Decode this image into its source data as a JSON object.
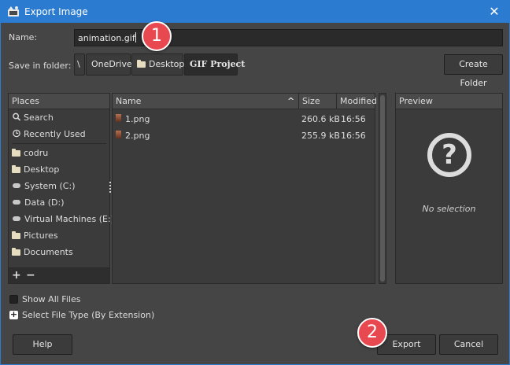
{
  "window": {
    "title": "Export Image",
    "close_glyph": "✕",
    "accent_color": "#2b7bd1"
  },
  "name_row": {
    "label": "Name:",
    "value": "animation.gif"
  },
  "folder_row": {
    "label": "Save in folder:",
    "crumbs": [
      "\\",
      "OneDrive",
      "Desktop",
      "GIF Project"
    ],
    "create_folder_label": "Create Folder"
  },
  "places": {
    "header": "Places",
    "items": [
      {
        "label": "Search",
        "icon": "search-icon"
      },
      {
        "label": "Recently Used",
        "icon": "clock-icon"
      },
      {
        "label": "codru",
        "icon": "folder-icon"
      },
      {
        "label": "Desktop",
        "icon": "folder-icon"
      },
      {
        "label": "System (C:)",
        "icon": "drive-icon"
      },
      {
        "label": "Data (D:)",
        "icon": "drive-icon"
      },
      {
        "label": "Virtual Machines (E:)",
        "icon": "drive-icon"
      },
      {
        "label": "Pictures",
        "icon": "folder-icon"
      },
      {
        "label": "Documents",
        "icon": "folder-icon"
      }
    ],
    "add_label": "+",
    "remove_label": "−"
  },
  "files": {
    "columns": {
      "name": "Name",
      "size": "Size",
      "modified": "Modified"
    },
    "sort_glyph": "^",
    "rows": [
      {
        "name": "1.png",
        "size": "260.6 kB",
        "modified": "16:56"
      },
      {
        "name": "2.png",
        "size": "255.9 kB",
        "modified": "16:56"
      }
    ]
  },
  "preview": {
    "header": "Preview",
    "icon_glyph": "?",
    "empty_text": "No selection"
  },
  "options": {
    "show_all_files": "Show All Files",
    "select_file_type": "Select File Type (By Extension)",
    "expander_glyph": "+"
  },
  "buttons": {
    "help": "Help",
    "export": "Export",
    "cancel": "Cancel"
  },
  "callouts": {
    "first": "1",
    "second": "2",
    "color": "#e8484f"
  }
}
